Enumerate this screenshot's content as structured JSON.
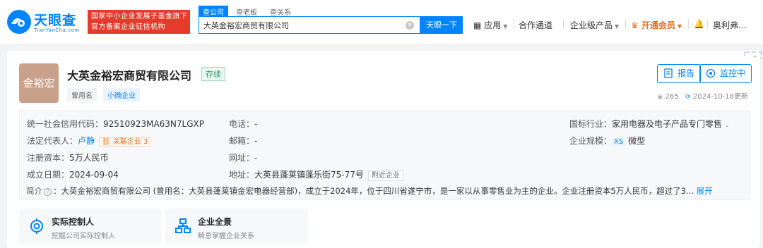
{
  "header": {
    "logo_text": "天眼查",
    "logo_sub": "TianYanCha.com",
    "badge_line1": "国家中小企业发展子基金旗下",
    "badge_line2": "官方备案企业征信机构",
    "search_tabs": [
      "查公司",
      "查老板",
      "查关系"
    ],
    "search_value": "大英金裕宏商贸有限公司",
    "search_button": "天眼一下",
    "nav": {
      "app": "应用",
      "partner": "合作通道",
      "enterprise": "企业级产品",
      "vip": "开通会员",
      "user": "奥利弗..."
    }
  },
  "company": {
    "logo_text": "金裕宏",
    "name": "大英金裕宏商贸有限公司",
    "status": "存续",
    "former_name_label": "曾用名",
    "scale_tag": "小微企业",
    "report_btn": "报告",
    "monitor_btn": "监控中",
    "views": "265",
    "updated": "2024-10-18更新"
  },
  "info": {
    "credit_code_label": "统一社会信用代码：",
    "credit_code": "92510923MA63N7LGXP",
    "legal_rep_label": "法定代表人：",
    "legal_rep": "卢静",
    "related_label": "关联企业",
    "related_count": "3",
    "capital_label": "注册资本：",
    "capital": "5万人民币",
    "founded_label": "成立日期：",
    "founded": "2024-09-04",
    "phone_label": "电话：",
    "phone": "-",
    "email_label": "邮箱：",
    "email": "-",
    "website_label": "网址：",
    "website": "-",
    "address_label": "地址：",
    "address": "大英县蓬莱镇蓬乐街75-77号",
    "nearby_btn": "附近企业",
    "industry_label": "国标行业：",
    "industry": "家用电器及电子产品专门零售",
    "scale_label": "企业规模：",
    "scale_code": "XS",
    "scale_value": "微型",
    "intro_label": "简介",
    "intro": "：大英金裕宏商贸有限公司 (曾用名：大英县蓬莱镇金宏电器经营部)，成立于2024年，位于四川省遂宁市，是一家以从事零售业为主的企业。企业注册资本5万人民币，超过了3...",
    "expand": "展开"
  },
  "bottom_cards": [
    {
      "title": "实际控制人",
      "subtitle": "挖掘公司实际控制人"
    },
    {
      "title": "企业全景",
      "subtitle": "瞬息掌握企业关系"
    }
  ],
  "colors": {
    "brand": "#0084ff",
    "badge_red": "#e43b2c",
    "vip_orange": "#e4701c",
    "status_green": "#1f9c6f",
    "avatar_bg": "#c9a08a"
  }
}
